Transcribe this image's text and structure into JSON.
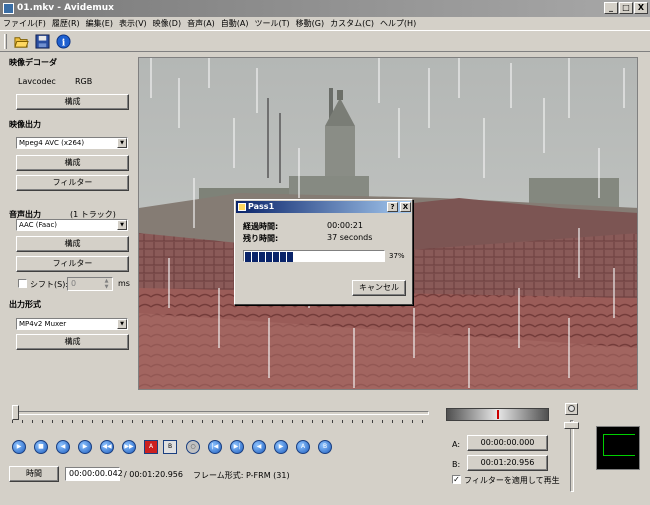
{
  "window": {
    "title": "01.mkv - Avidemux",
    "minimize": "_",
    "maximize": "□",
    "close": "X"
  },
  "menu": [
    "ファイル(F)",
    "履歴(R)",
    "編集(E)",
    "表示(V)",
    "映像(D)",
    "音声(A)",
    "自動(A)",
    "ツール(T)",
    "移動(G)",
    "カスタム(C)",
    "ヘルプ(H)"
  ],
  "toolbar": {
    "icons": [
      "open-folder-icon",
      "save-disk-icon",
      "info-icon"
    ],
    "info_glyph": "i"
  },
  "sidebar": {
    "video_decoder": {
      "header": "映像デコーダ",
      "codec": "Lavcodec",
      "colorspace": "RGB",
      "configure": "構成"
    },
    "video_output": {
      "header": "映像出力",
      "codec": "Mpeg4 AVC (x264)",
      "configure": "構成",
      "filters": "フィルター"
    },
    "audio_output": {
      "header": "音声出力",
      "tracks": "(1 トラック)",
      "codec": "AAC (Faac)",
      "configure": "構成",
      "filters": "フィルター",
      "shift_label": "シフト(S):",
      "shift_value": "0",
      "shift_unit": "ms"
    },
    "output_format": {
      "header": "出力形式",
      "muxer": "MP4v2 Muxer",
      "configure": "構成"
    }
  },
  "dialog": {
    "title": "Pass1",
    "help": "?",
    "close": "X",
    "elapsed_label": "経過時間:",
    "elapsed_value": "00:00:21",
    "remaining_label": "残り時間:",
    "remaining_value": "37 seconds",
    "progress": 0.37,
    "progress_text": "37%",
    "cancel": "キャンセル"
  },
  "playback": {
    "buttons": [
      "play-icon",
      "stop-icon",
      "previous-frame-icon",
      "next-frame-icon",
      "back-keyframe-icon",
      "forward-keyframe-icon",
      "set-marker-a-icon",
      "set-marker-b-icon",
      "previous-black-icon",
      "goto-start-icon",
      "goto-end-icon",
      "previous-cut-icon",
      "next-cut-icon",
      "goto-marker-a-icon",
      "goto-marker-b-icon"
    ],
    "button_glyphs": [
      "▶",
      "■",
      "◀",
      "▶",
      "◀◀",
      "▶▶",
      "A",
      "B",
      "○",
      "|◀",
      "▶|",
      "◀",
      "▶",
      "A",
      "B"
    ],
    "time_button": "時間",
    "current_time": "00:00:00.042",
    "total_time": "/ 00:01:20.956",
    "frame_type": "フレーム形式: P-FRM (31)",
    "position": 0
  },
  "selection": {
    "a_label": "A:",
    "a_value": "00:00:00.000",
    "b_label": "B:",
    "b_value": "00:01:20.956",
    "apply_filters_label": "フィルターを適用して再生",
    "apply_filters_checked": true,
    "check_glyph": "✓"
  },
  "colors": {
    "progress": "#0a246a",
    "marker": "#cc0000",
    "meter_trace": "#00d000"
  }
}
